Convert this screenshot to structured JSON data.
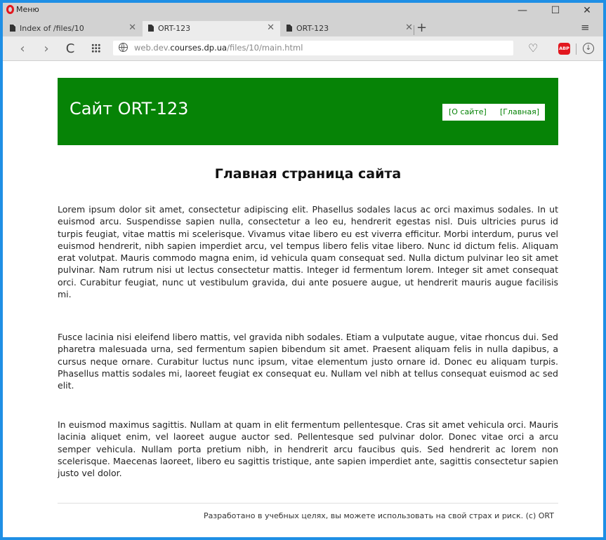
{
  "browser": {
    "menu_label": "Меню",
    "window_controls": {
      "minimize": "—",
      "maximize": "☐",
      "close": "✕"
    },
    "tabs": [
      {
        "title": "Index of /files/10",
        "active": false
      },
      {
        "title": "ORT-123",
        "active": true
      },
      {
        "title": "ORT-123",
        "active": false
      }
    ],
    "new_tab": "+",
    "tabs_menu": "≡",
    "nav": {
      "back": "‹",
      "forward": "›",
      "reload": "C"
    },
    "url": {
      "prefix": "web.dev.",
      "host": "courses.dp.ua",
      "path": "/files/10/main.html"
    },
    "heart": "♡",
    "abp": "ABP",
    "download": "↓",
    "accent_color": "#1f8fe5"
  },
  "site": {
    "header_color": "#068306",
    "title": "Сайт ORT-123",
    "nav": [
      "[О сайте]",
      "[Главная]"
    ],
    "heading": "Главная страница сайта",
    "paragraphs": [
      "Lorem ipsum dolor sit amet, consectetur adipiscing elit. Phasellus sodales lacus ac orci maximus sodales. In ut euismod arcu. Suspendisse sapien nulla, consectetur a leo eu, hendrerit egestas nisl. Duis ultricies purus id turpis feugiat, vitae mattis mi scelerisque. Vivamus vitae libero eu est viverra efficitur. Morbi interdum, purus vel euismod hendrerit, nibh sapien imperdiet arcu, vel tempus libero felis vitae libero. Nunc id dictum felis. Aliquam erat volutpat. Mauris commodo magna enim, id vehicula quam consequat sed. Nulla dictum pulvinar leo sit amet pulvinar. Nam rutrum nisi ut lectus consectetur mattis. Integer id fermentum lorem. Integer sit amet consequat orci. Curabitur feugiat, nunc ut vestibulum gravida, dui ante posuere augue, ut hendrerit mauris augue facilisis mi.",
      "Fusce lacinia nisi eleifend libero mattis, vel gravida nibh sodales. Etiam a vulputate augue, vitae rhoncus dui. Sed pharetra malesuada urna, sed fermentum sapien bibendum sit amet. Praesent aliquam felis in nulla dapibus, a cursus neque ornare. Curabitur luctus nunc ipsum, vitae elementum justo ornare id. Donec eu aliquam turpis. Phasellus mattis sodales mi, laoreet feugiat ex consequat eu. Nullam vel nibh at tellus consequat euismod ac sed elit.",
      "In euismod maximus sagittis. Nullam at quam in elit fermentum pellentesque. Cras sit amet vehicula orci. Mauris lacinia aliquet enim, vel laoreet augue auctor sed. Pellentesque sed pulvinar dolor. Donec vitae orci a arcu semper vehicula. Nullam porta pretium nibh, in hendrerit arcu faucibus quis. Sed hendrerit ac lorem non scelerisque. Maecenas laoreet, libero eu sagittis tristique, ante sapien imperdiet ante, sagittis consectetur sapien justo vel dolor."
    ],
    "footer": "Разработано в учебных целях, вы можете использовать на свой страх и риск. (c) ORT"
  }
}
